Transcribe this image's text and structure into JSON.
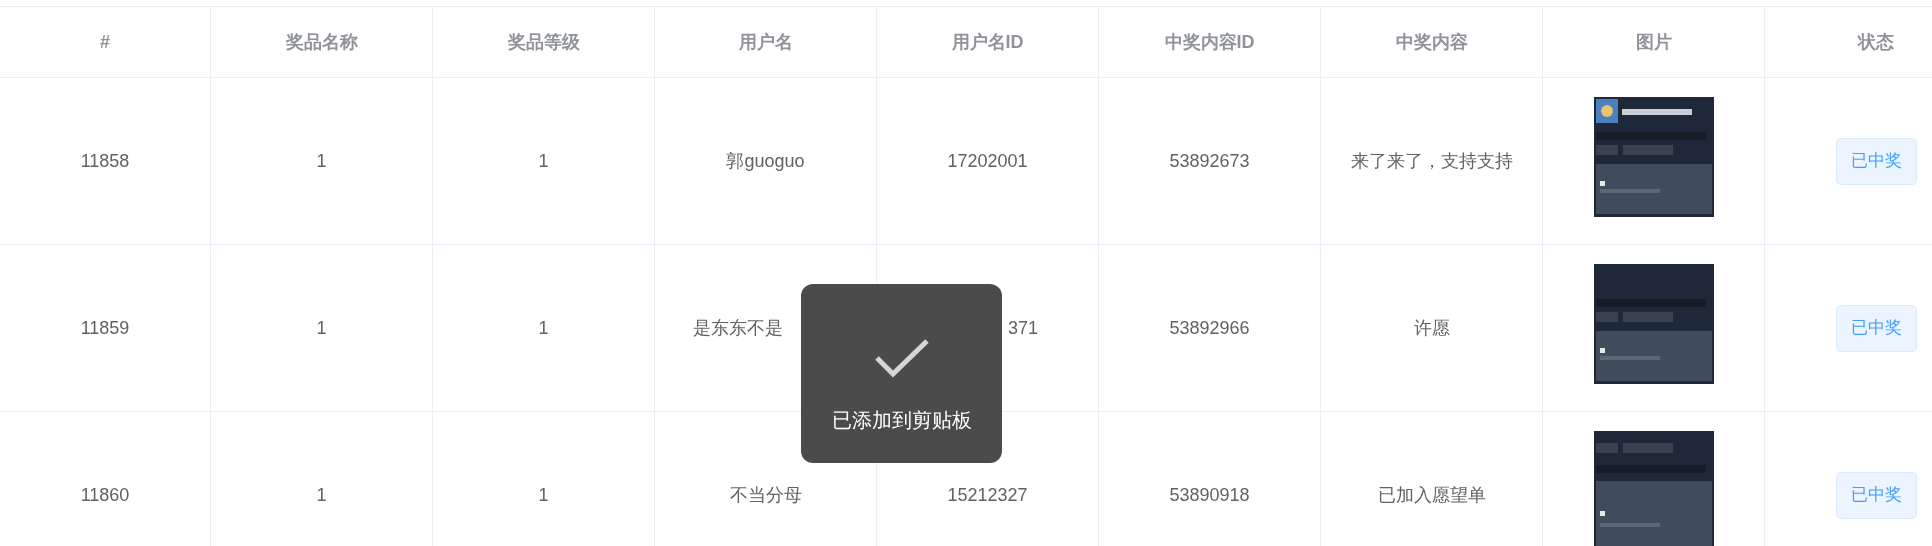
{
  "table": {
    "columns": [
      "#",
      "奖品名称",
      "奖品等级",
      "用户名",
      "用户名ID",
      "中奖内容ID",
      "中奖内容",
      "图片",
      "状态"
    ],
    "rows": [
      {
        "cells": [
          "11858",
          "1",
          "1",
          "郭guoguo",
          "17202001",
          "53892673",
          "来了来了，支持支持"
        ],
        "status": "已中奖"
      },
      {
        "cells": [
          "11859",
          "1",
          "1",
          {
            "text": "是东东不是",
            "covered_end": true
          },
          {
            "text": "371",
            "covered_start": true
          },
          "53892966",
          "许愿"
        ],
        "status": "已中奖"
      },
      {
        "cells": [
          "11860",
          "1",
          "1",
          "不当分母",
          "15212327",
          "53890918",
          "已加入愿望单"
        ],
        "status": "已中奖"
      }
    ]
  },
  "toast": {
    "message": "已添加到剪贴板"
  }
}
